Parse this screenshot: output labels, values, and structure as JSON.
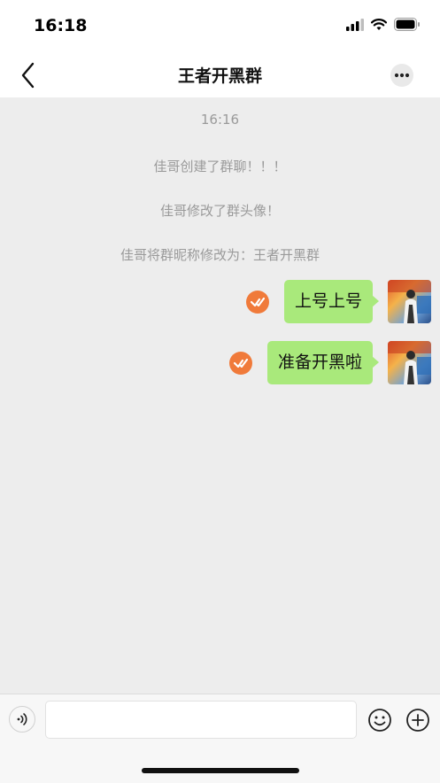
{
  "status": {
    "time": "16:18"
  },
  "nav": {
    "title": "王者开黑群",
    "back_icon": "chevron-left-icon",
    "more_icon": "more-dots-icon"
  },
  "chat": {
    "timestamp": "16:16",
    "system_messages": [
      "佳哥创建了群聊！！！",
      "佳哥修改了群头像！",
      "佳哥将群昵称修改为：王者开黑群"
    ],
    "messages": [
      {
        "text": "上号上号",
        "status_icon": "check-badge-icon"
      },
      {
        "text": "准备开黑啦",
        "status_icon": "check-badge-icon"
      }
    ]
  },
  "input": {
    "placeholder": "",
    "voice_icon": "voice-icon",
    "emoji_icon": "emoji-icon",
    "plus_icon": "plus-icon"
  },
  "colors": {
    "bubble": "#a9e97b",
    "check": "#f07a3a",
    "background": "#ededed"
  }
}
